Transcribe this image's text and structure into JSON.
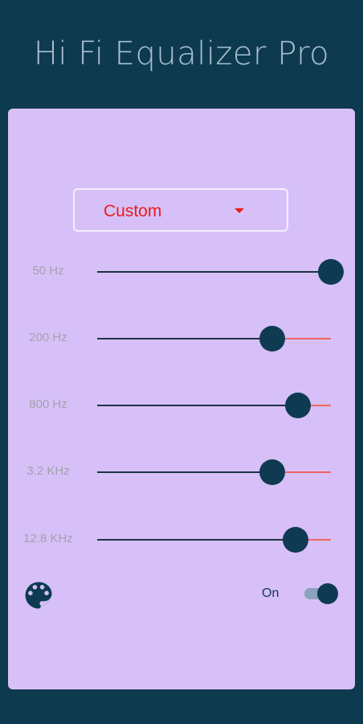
{
  "app": {
    "title": "Hi Fi Equalizer Pro"
  },
  "preset": {
    "selected": "Custom"
  },
  "bands": [
    {
      "label": "50 Hz",
      "level": 1.0
    },
    {
      "label": "200 Hz",
      "level": 0.75
    },
    {
      "label": "800 Hz",
      "level": 0.86
    },
    {
      "label": "3.2 KHz",
      "level": 0.75
    },
    {
      "label": "12.8 KHz",
      "level": 0.85
    }
  ],
  "toggle": {
    "label": "On",
    "state": true
  },
  "colors": {
    "background": "#0e3a4f",
    "panel": "#d7c0f7",
    "accent": "#ea1c1c",
    "thumb": "#0f3b52",
    "track_remaining": "#ef6461"
  },
  "icons": {
    "theme": "palette-icon",
    "dropdown": "caret-down-icon"
  }
}
